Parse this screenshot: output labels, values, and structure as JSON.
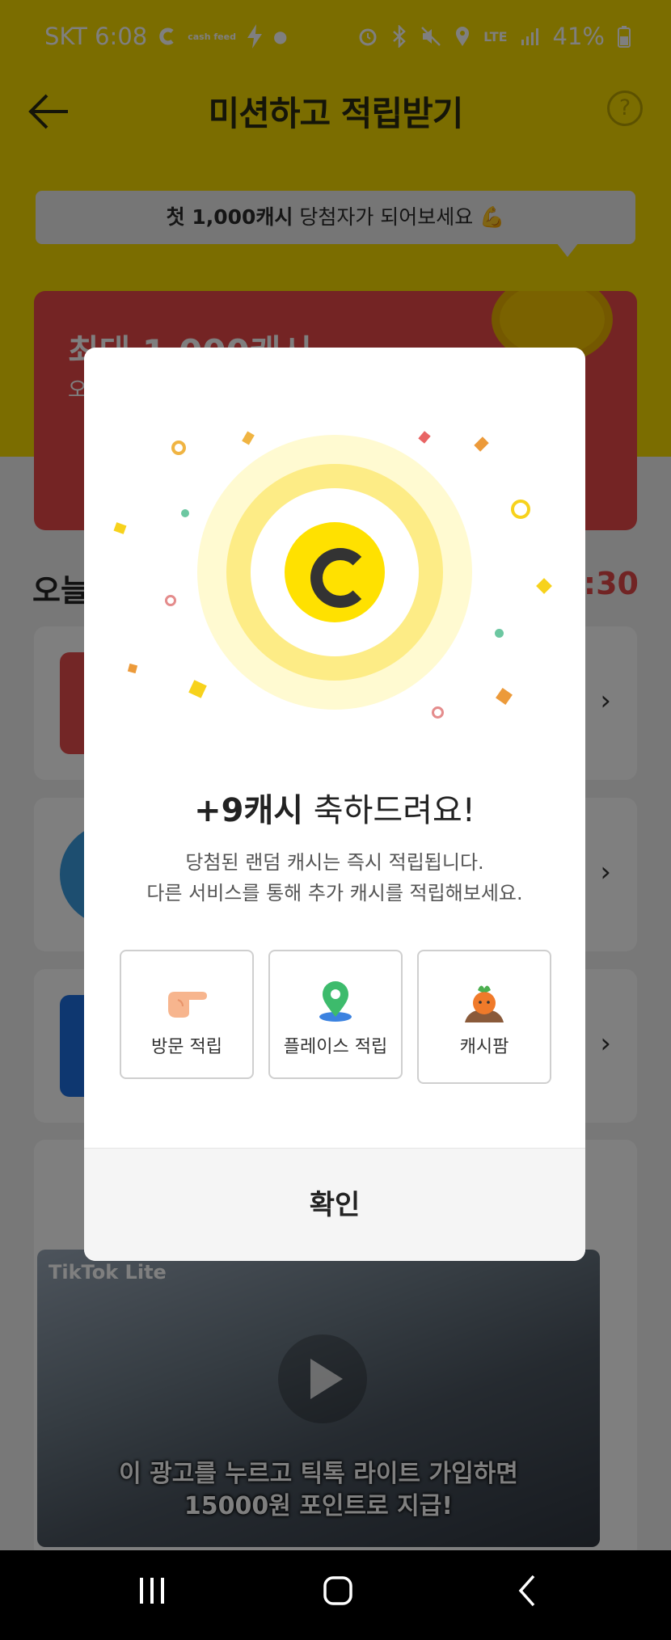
{
  "status_bar": {
    "carrier_time": "SKT 6:08",
    "cashfeed": "cash feed",
    "network": "LTE",
    "battery": "41%"
  },
  "header": {
    "title": "미션하고 적립받기",
    "help": "?"
  },
  "promo": {
    "tooltip_bold": "첫 1,000캐시",
    "tooltip_rest": " 당첨자가 되어보세요 💪",
    "banner_title": "최대 1,000캐시",
    "banner_sub": "오"
  },
  "today": {
    "label": "오늘",
    "timer": "2:30"
  },
  "ad": {
    "logo": "TikTok Lite",
    "caption_line1": "이 광고를 누르고 틱톡 라이트 가입하면",
    "caption_line2": "15000원 포인트로 지급!"
  },
  "modal": {
    "heading_bold": "+9캐시",
    "heading_rest": " 축하드려요!",
    "desc_line1": "당첨된 랜덤 캐시는 즉시 적립됩니다.",
    "desc_line2": "다른 서비스를 통해 추가 캐시를 적립해보세요.",
    "options": [
      {
        "label": "방문 적립",
        "icon": "pointing-hand-icon"
      },
      {
        "label": "플레이스 적립",
        "icon": "map-pin-icon"
      },
      {
        "label": "캐시팜",
        "icon": "carrot-icon"
      }
    ],
    "confirm": "확인"
  },
  "colors": {
    "brand_yellow": "#f6da00",
    "coin_yellow": "#ffe100",
    "promo_red": "#e94848"
  }
}
